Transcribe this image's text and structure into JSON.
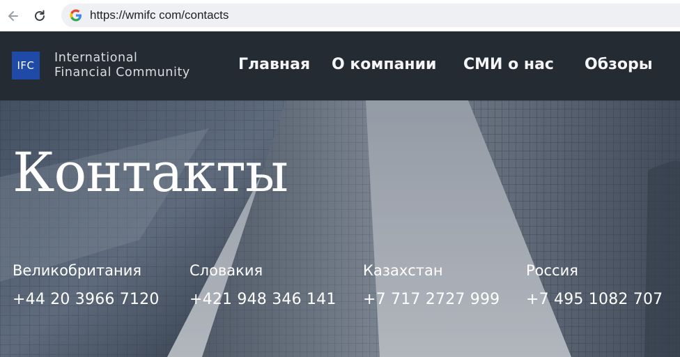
{
  "browser": {
    "url": "https://wmifc com/contacts",
    "icons": [
      "arrow-back-icon",
      "reload-icon",
      "google-icon"
    ]
  },
  "header": {
    "logo_badge": "IFC",
    "logo_line1": "International",
    "logo_line2": "Financial Community",
    "nav": [
      {
        "label": "Главная"
      },
      {
        "label": "О компании"
      },
      {
        "label": "СМИ о нас"
      },
      {
        "label": "Обзоры"
      }
    ],
    "colors": {
      "header_bg": "#252b33",
      "logo_bg": "#1f4aa8"
    }
  },
  "hero": {
    "title": "Контакты",
    "contacts": [
      {
        "country": "Великобритания",
        "phone": "+44 20 3966 7120"
      },
      {
        "country": "Словакия",
        "phone": "+421 948 346 141"
      },
      {
        "country": "Казахстан",
        "phone": "+7 717 2727 999"
      },
      {
        "country": "Россия",
        "phone": "+7 495 1082 707"
      }
    ]
  }
}
